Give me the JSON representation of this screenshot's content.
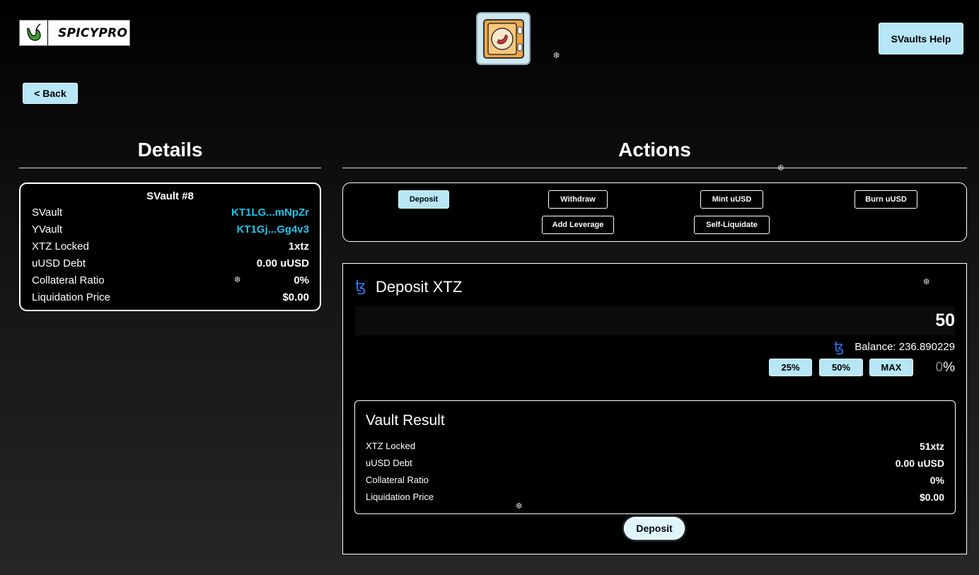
{
  "header": {
    "brand": "SPICYPRO",
    "help_label": "SVaults Help",
    "back_label": "< Back"
  },
  "details": {
    "section_title": "Details",
    "card_title": "SVault #8",
    "rows": [
      {
        "label": "SVault",
        "value": "KT1LG...mNpZr"
      },
      {
        "label": "YVault",
        "value": "KT1Gj...Gg4v3"
      },
      {
        "label": "XTZ Locked",
        "value": "1xtz"
      },
      {
        "label": "uUSD Debt",
        "value": "0.00 uUSD"
      },
      {
        "label": "Collateral Ratio",
        "value": "0%"
      },
      {
        "label": "Liquidation Price",
        "value": "$0.00"
      }
    ]
  },
  "actions": {
    "section_title": "Actions",
    "buttons": [
      "Deposit",
      "Withdraw",
      "Mint uUSD",
      "Burn uUSD",
      "Add Leverage",
      "Self-Liquidate"
    ],
    "active": "Deposit"
  },
  "deposit": {
    "title": "Deposit XTZ",
    "tez_symbol": "ꜩ",
    "amount": "50",
    "balance": "Balance: 236.890229",
    "pct_buttons": [
      "25%",
      "50%",
      "MAX"
    ],
    "pct_value": "0",
    "pct_unit": "%",
    "result": {
      "title": "Vault Result",
      "rows": [
        {
          "label": "XTZ Locked",
          "value": "51xtz"
        },
        {
          "label": "uUSD Debt",
          "value": "0.00 uUSD"
        },
        {
          "label": "Collateral Ratio",
          "value": "0%"
        },
        {
          "label": "Liquidation Price",
          "value": "$0.00"
        }
      ]
    },
    "submit_label": "Deposit"
  },
  "colors": {
    "accent": "#b7e6f7",
    "link": "#1ec3ea",
    "tez": "#2d74e6"
  }
}
